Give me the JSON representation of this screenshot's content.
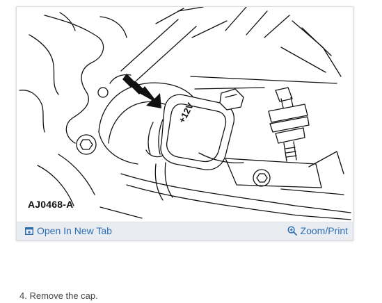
{
  "figure": {
    "id_label": "AJ0468-A",
    "callout_label": "+12V"
  },
  "actions": {
    "open_new_tab": "Open In New Tab",
    "zoom_print": "Zoom/Print"
  },
  "icons": {
    "open_new_tab": "open-tab-icon",
    "zoom_print": "zoom-in-icon"
  },
  "step": {
    "text": "4. Remove the cap."
  },
  "colors": {
    "link": "#2c6db2",
    "action_bar_bg": "#e9edf2"
  }
}
